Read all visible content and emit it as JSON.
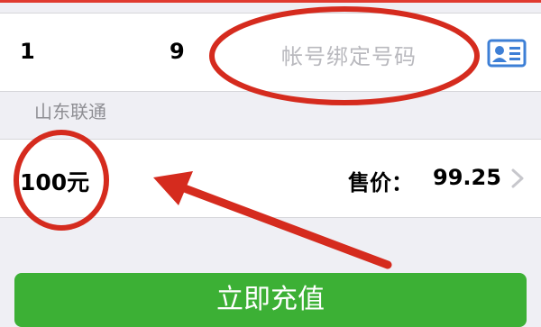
{
  "phone": {
    "number_start": "1",
    "number_end": "9",
    "placeholder": "帐号绑定号码"
  },
  "carrier": "山东联通",
  "recharge": {
    "amount": "100元",
    "price_label": "售价：",
    "price_value": "99.25"
  },
  "action": {
    "button_label": "立即充值"
  },
  "icons": {
    "contact": "contact-card-icon",
    "chevron": "chevron-right-icon"
  },
  "colors": {
    "annotation_red": "#d52b1e",
    "button_green": "#3cb035",
    "icon_blue": "#3d7fd6"
  }
}
